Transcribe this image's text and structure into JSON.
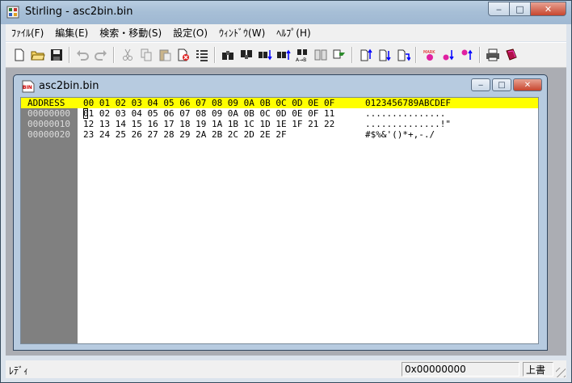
{
  "window": {
    "title": "Stirling - asc2bin.bin",
    "minimize": "‒",
    "maximize": "□",
    "close": "✕"
  },
  "menu": [
    "ﾌｧｲﾙ(F)",
    "編集(E)",
    "検索・移動(S)",
    "設定(O)",
    "ｳｨﾝﾄﾞｳ(W)",
    "ﾍﾙﾌﾟ(H)"
  ],
  "toolbar": {
    "buttons": [
      "new-file",
      "open-file",
      "save",
      "undo",
      "redo",
      "cut",
      "copy",
      "paste",
      "delete",
      "list",
      "find",
      "find-next",
      "find-prev",
      "find-back",
      "find-hex",
      "compare",
      "jump",
      "go-start",
      "go-end",
      "go-next",
      "mark",
      "mark-next",
      "mark-prev",
      "print",
      "book"
    ]
  },
  "document": {
    "title": "asc2bin.bin",
    "icon_label": "BIN",
    "header": {
      "address": "ADDRESS",
      "hex": "00 01 02 03 04 05 06 07 08 09 0A 0B 0C 0D 0E 0F",
      "ascii": "0123456789ABCDEF"
    },
    "rows": [
      {
        "address": "00000000",
        "hex": "01 02 03 04 05 06 07 08 09 0A 0B 0C 0D 0E 0F 11",
        "ascii": "..............."
      },
      {
        "address": "00000010",
        "hex": "12 13 14 15 16 17 18 19 1A 1B 1C 1D 1E 1F 21 22",
        "ascii": "..............!\""
      },
      {
        "address": "00000020",
        "hex": "23 24 25 26 27 28 29 2A 2B 2C 2D 2E 2F",
        "ascii": "#$%&'()*+,-./"
      }
    ]
  },
  "status": {
    "text": "ﾚﾃﾞｨ",
    "offset": "0x00000000",
    "mode": "上書"
  },
  "colors": {
    "header_bg": "#ffff00",
    "address_bg": "#808080",
    "editor_bg": "#ffffff"
  }
}
